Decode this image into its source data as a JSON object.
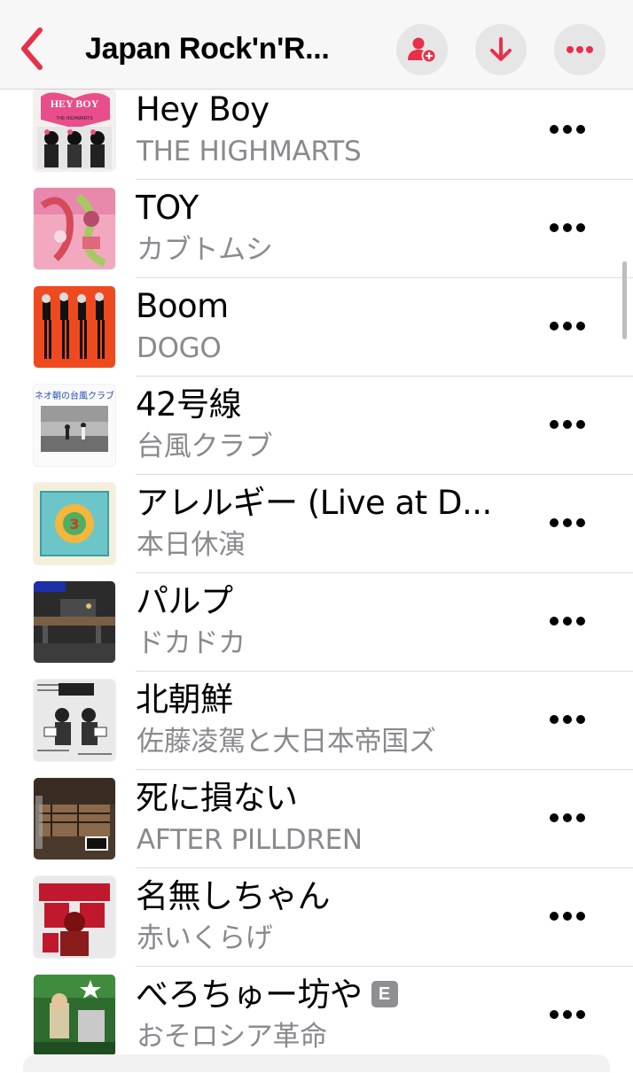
{
  "header": {
    "title": "Japan Rock'n'R...",
    "back_icon": "chevron-left-icon",
    "buttons": [
      "add-friend-icon",
      "download-icon",
      "more-icon"
    ],
    "accent_color": "#e8304a"
  },
  "songs": [
    {
      "title": "Hey Boy",
      "artist": "THE HIGHMARTS",
      "explicit": false
    },
    {
      "title": "TOY",
      "artist": "カブトムシ",
      "explicit": false
    },
    {
      "title": "Boom",
      "artist": "DOGO",
      "explicit": false
    },
    {
      "title": "42号線",
      "artist": "台風クラブ",
      "explicit": false
    },
    {
      "title": "アレルギー (Live at D...",
      "artist": "本日休演",
      "explicit": false
    },
    {
      "title": "パルプ",
      "artist": "ドカドカ",
      "explicit": false
    },
    {
      "title": "北朝鮮",
      "artist": "佐藤凌駕と大日本帝国ズ",
      "explicit": false
    },
    {
      "title": "死に損ない",
      "artist": "AFTER PILLDREN",
      "explicit": false
    },
    {
      "title": "名無しちゃん",
      "artist": "赤いくらげ",
      "explicit": false
    },
    {
      "title": "べろちゅー坊や",
      "artist": "おそロシア革命",
      "explicit": true,
      "explicit_label": "E"
    }
  ],
  "artwork_text": {
    "hey_boy": "HEY BOY",
    "hey_boy_sub": "THE HIGHMARTS",
    "typhoon": "ネオ朝の台風クラブ"
  }
}
